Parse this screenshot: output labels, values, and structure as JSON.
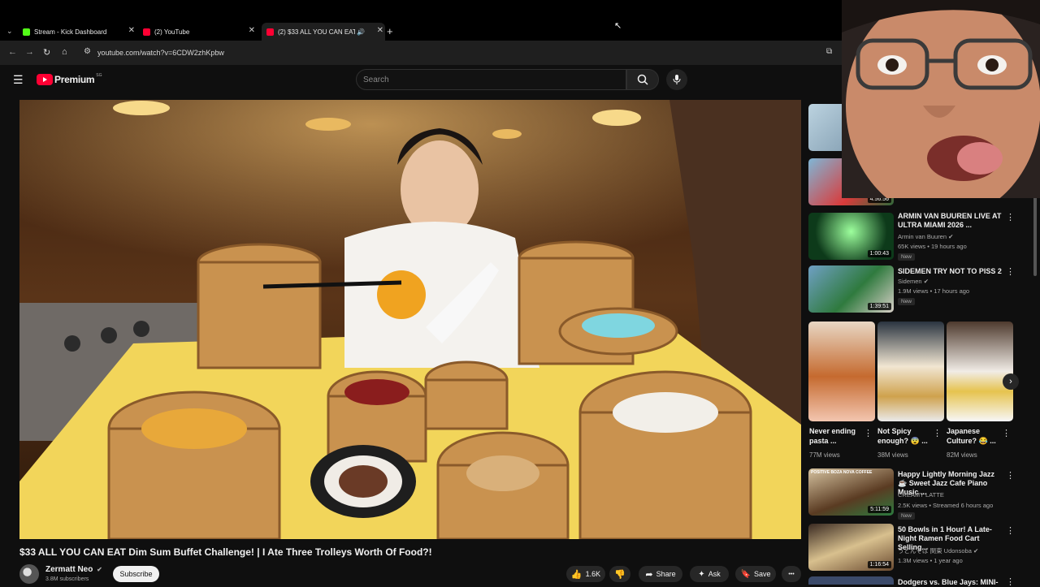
{
  "browser": {
    "tabs": [
      {
        "title": "Stream - Kick Dashboard",
        "favicon_color": "#53fc18"
      },
      {
        "title": "(2) YouTube",
        "favicon_color": "#ff0033"
      },
      {
        "title": "(2) $33 ALL YOU CAN EAT I",
        "favicon_color": "#ff0033"
      }
    ],
    "new_tab_label": "+",
    "url": "youtube.com/watch?v=6CDW2zhKpbw"
  },
  "youtube": {
    "logo_text": "Premium",
    "logo_badge": "SG",
    "search_placeholder": "Search"
  },
  "video": {
    "title": "$33 ALL YOU CAN EAT Dim Sum Buffet Challenge! | I Ate Three Trolleys Worth Of Food?!",
    "channel": "Zermatt Neo",
    "subscribers": "3.8M subscribers",
    "subscribe_label": "Subscribe",
    "like_count": "1.6K",
    "share_label": "Share",
    "ask_label": "Ask",
    "save_label": "Save",
    "more_label": "•••"
  },
  "sidebar": {
    "top_durations": [
      "",
      "4:56:56"
    ],
    "recommended": [
      {
        "title": "ARMIN VAN BUUREN LIVE AT ULTRA MIAMI 2026 ...",
        "channel": "Armin van Buuren",
        "meta": "65K views • 19 hours ago",
        "badge": "New",
        "duration": "1:00:43"
      },
      {
        "title": "SIDEMEN TRY NOT TO PISS 2",
        "channel": "Sidemen",
        "meta": "1.9M views • 17 hours ago",
        "badge": "New",
        "duration": "1:39:51"
      }
    ],
    "shorts": [
      {
        "title": "Never ending pasta ...",
        "views": "77M views"
      },
      {
        "title": "Not Spicy enough? 😨 ...",
        "views": "38M views"
      },
      {
        "title": "Japanese Culture? 😂 ...",
        "views": "82M views"
      }
    ],
    "more_recommended": [
      {
        "title": "Happy Lightly Morning Jazz ☕ Sweet Jazz Cafe Piano Music ...",
        "channel": "CREAMY LATTE",
        "meta": "2.5K views • Streamed 6 hours ago",
        "badge": "New",
        "duration": "5:11:59",
        "thumb_caption": "POSITIVE BOZA NOVA COFFEE"
      },
      {
        "title": "50 Bowls in 1 Hour! A Late-Night Ramen Food Cart Selling...",
        "channel": "うどんそば 関東 Udonsoba",
        "meta": "1.3M views • 1 year ago",
        "badge": "",
        "duration": "1:16:54"
      },
      {
        "title": "Dodgers vs. Blue Jays: MINI-",
        "channel": "",
        "meta": "",
        "badge": "",
        "duration": ""
      }
    ]
  },
  "colors": {
    "youtube_red": "#ff0033",
    "kick_green": "#53fc18",
    "bamboo": "#c9924f",
    "tablecloth": "#f2d55a"
  }
}
